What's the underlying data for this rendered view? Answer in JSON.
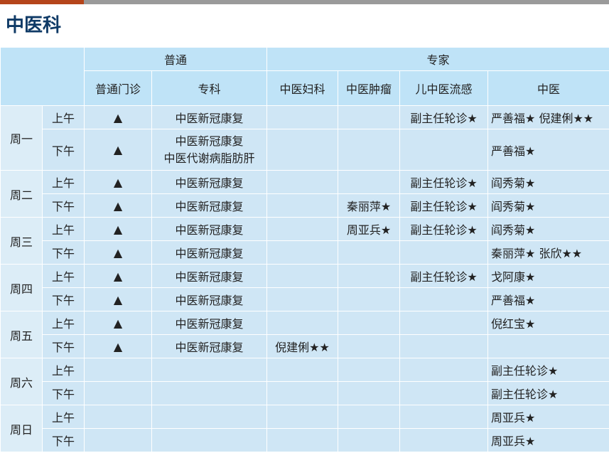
{
  "page": {
    "title": "中医科",
    "accent_color": "#b5451b",
    "title_color": "#0f3a66",
    "header_bg": "#bfe3f7",
    "cell_bg": "#cfe6f5"
  },
  "header": {
    "group_general": "普通",
    "group_expert": "专家",
    "columns": [
      "普通门诊",
      "专科",
      "中医妇科",
      "中医肿瘤",
      "儿中医流感",
      "中医"
    ]
  },
  "schedule": [
    {
      "day": "周一",
      "slots": [
        {
          "period": "上午",
          "cells": [
            "▲",
            "中医新冠康复",
            "",
            "",
            "副主任轮诊★",
            "严善福★  倪建俐★★"
          ]
        },
        {
          "period": "下午",
          "cells": [
            "▲",
            "中医新冠康复\n中医代谢病脂肪肝",
            "",
            "",
            "",
            "严善福★"
          ]
        }
      ]
    },
    {
      "day": "周二",
      "slots": [
        {
          "period": "上午",
          "cells": [
            "▲",
            "中医新冠康复",
            "",
            "",
            "副主任轮诊★",
            "阎秀菊★"
          ]
        },
        {
          "period": "下午",
          "cells": [
            "▲",
            "中医新冠康复",
            "",
            "秦丽萍★",
            "副主任轮诊★",
            "阎秀菊★"
          ]
        }
      ]
    },
    {
      "day": "周三",
      "slots": [
        {
          "period": "上午",
          "cells": [
            "▲",
            "中医新冠康复",
            "",
            "周亚兵★",
            "副主任轮诊★",
            "阎秀菊★"
          ]
        },
        {
          "period": "下午",
          "cells": [
            "▲",
            "中医新冠康复",
            "",
            "",
            "",
            "秦丽萍★  张欣★★"
          ]
        }
      ]
    },
    {
      "day": "周四",
      "slots": [
        {
          "period": "上午",
          "cells": [
            "▲",
            "中医新冠康复",
            "",
            "",
            "副主任轮诊★",
            "戈阿康★"
          ]
        },
        {
          "period": "下午",
          "cells": [
            "▲",
            "中医新冠康复",
            "",
            "",
            "",
            "严善福★"
          ]
        }
      ]
    },
    {
      "day": "周五",
      "slots": [
        {
          "period": "上午",
          "cells": [
            "▲",
            "中医新冠康复",
            "",
            "",
            "",
            "倪红宝★"
          ]
        },
        {
          "period": "下午",
          "cells": [
            "▲",
            "中医新冠康复",
            "倪建俐★★",
            "",
            "",
            ""
          ]
        }
      ]
    },
    {
      "day": "周六",
      "slots": [
        {
          "period": "上午",
          "cells": [
            "",
            "",
            "",
            "",
            "",
            "副主任轮诊★"
          ]
        },
        {
          "period": "下午",
          "cells": [
            "",
            "",
            "",
            "",
            "",
            "副主任轮诊★"
          ]
        }
      ]
    },
    {
      "day": "周日",
      "slots": [
        {
          "period": "上午",
          "cells": [
            "",
            "",
            "",
            "",
            "",
            "周亚兵★"
          ]
        },
        {
          "period": "下午",
          "cells": [
            "",
            "",
            "",
            "",
            "",
            "周亚兵★"
          ]
        }
      ]
    }
  ]
}
